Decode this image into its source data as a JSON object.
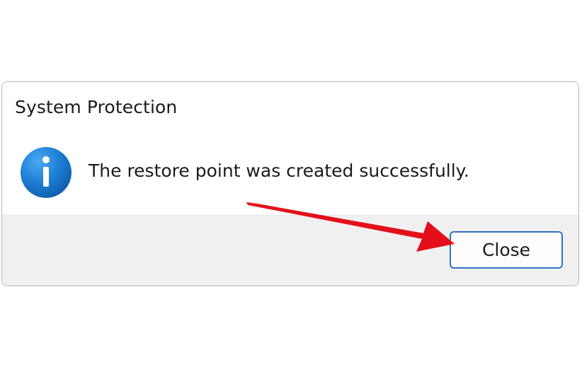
{
  "dialog": {
    "title": "System Protection",
    "icon": "info-icon",
    "message": "The restore point was created successfully.",
    "close_label": "Close"
  },
  "colors": {
    "accent_border": "#2f73c4",
    "footer_bg": "#f0f0f0",
    "icon_blue": "#1e7fd6",
    "annotation_arrow": "#e3101a"
  },
  "annotation": {
    "icon": "red-arrow-pointer"
  }
}
